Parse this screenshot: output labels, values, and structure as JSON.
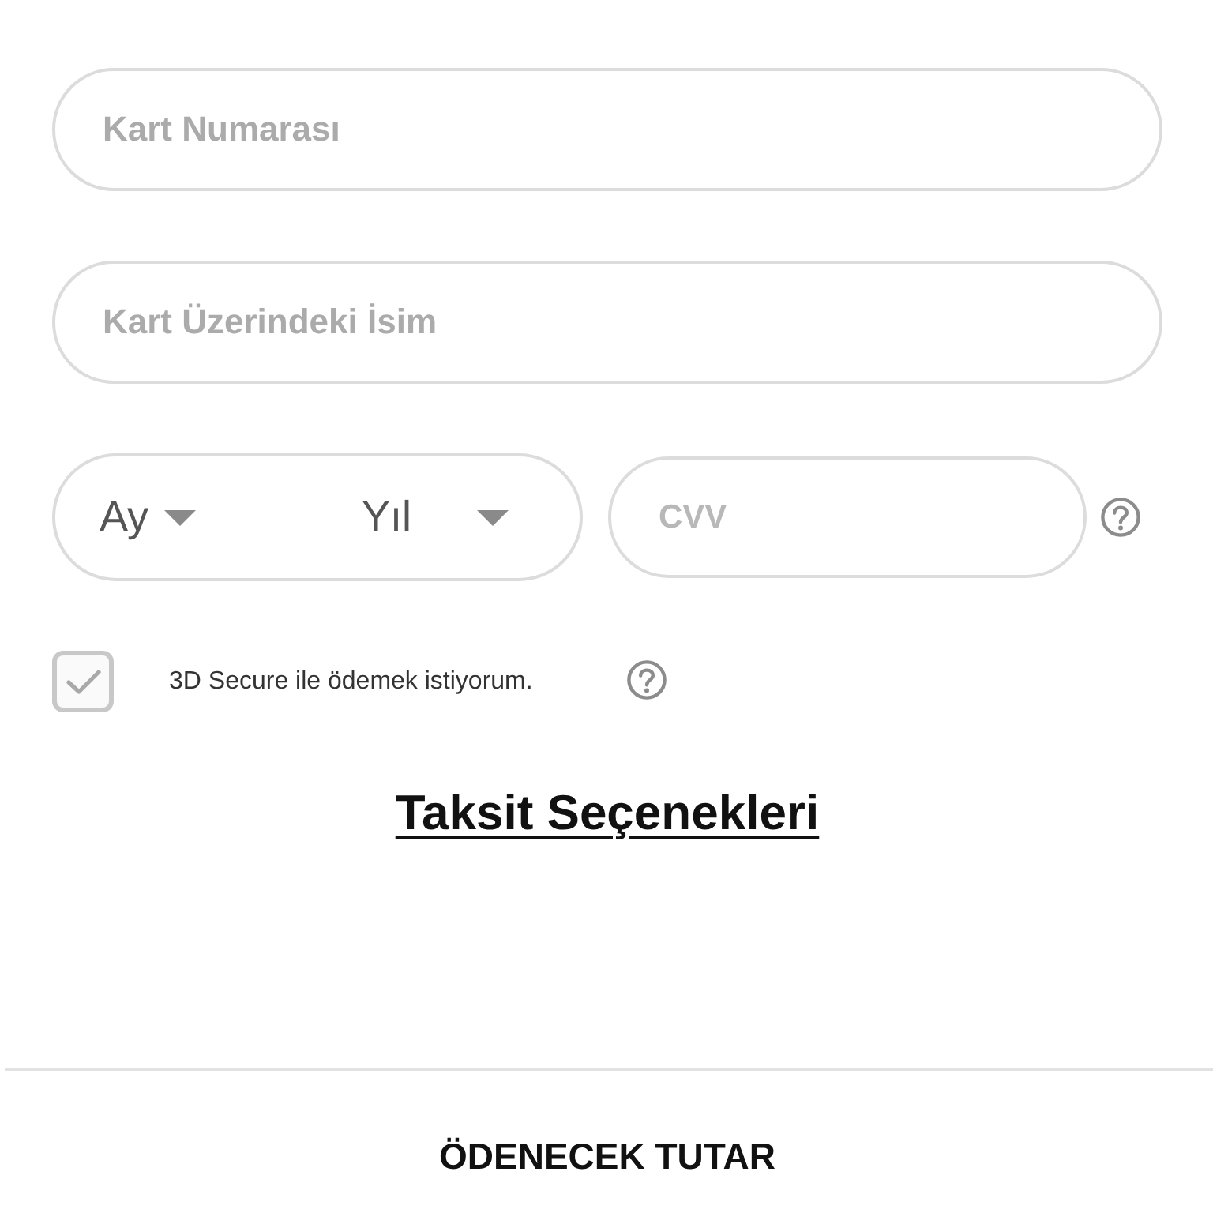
{
  "card_number": {
    "placeholder": "Kart Numarası"
  },
  "card_name": {
    "placeholder": "Kart Üzerindeki İsim"
  },
  "expiry": {
    "month": {
      "value": "Ay"
    },
    "year": {
      "value": "Yıl"
    }
  },
  "cvv": {
    "placeholder": "CVV"
  },
  "secure_3d": {
    "label": "3D Secure ile ödemek istiyorum.",
    "checked": true
  },
  "installments_link": {
    "label": "Taksit Seçenekleri"
  },
  "total": {
    "label": "ÖDENECEK TUTAR"
  }
}
